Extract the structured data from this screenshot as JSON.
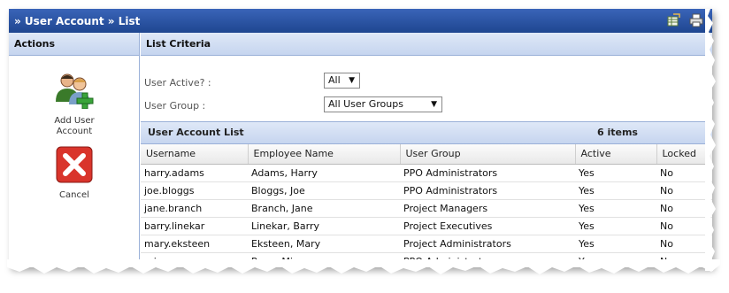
{
  "titlebar": {
    "breadcrumb": "» User Account » List"
  },
  "actions": {
    "header": "Actions",
    "items": [
      {
        "label": "Add User Account",
        "icon": "add-user-icon"
      },
      {
        "label": "Cancel",
        "icon": "cancel-icon"
      }
    ]
  },
  "criteria": {
    "header": "List Criteria",
    "user_active_label": "User Active? :",
    "user_active_value": "All",
    "user_group_label": "User Group :",
    "user_group_value": "All User Groups"
  },
  "list": {
    "title": "User Account List",
    "count": "6 items",
    "columns": [
      "Username",
      "Employee Name",
      "User Group",
      "Active",
      "Locked"
    ],
    "rows": [
      [
        "harry.adams",
        "Adams, Harry",
        "PPO Administrators",
        "Yes",
        "No"
      ],
      [
        "joe.bloggs",
        "Bloggs, Joe",
        "PPO Administrators",
        "Yes",
        "No"
      ],
      [
        "jane.branch",
        "Branch, Jane",
        "Project Managers",
        "Yes",
        "No"
      ],
      [
        "barry.linekar",
        "Linekar, Barry",
        "Project Executives",
        "Yes",
        "No"
      ],
      [
        "mary.eksteen",
        "Eksteen, Mary",
        "Project Administrators",
        "Yes",
        "No"
      ],
      [
        "mia.roux",
        "Roux, Mia",
        "PPO Administrators",
        "Yes",
        "No"
      ]
    ]
  },
  "colors": {
    "titlebar": "#2a55a8",
    "header_bg": "#cfdcf2",
    "cancel": "#d9342b",
    "add_green": "#3aa43a"
  }
}
